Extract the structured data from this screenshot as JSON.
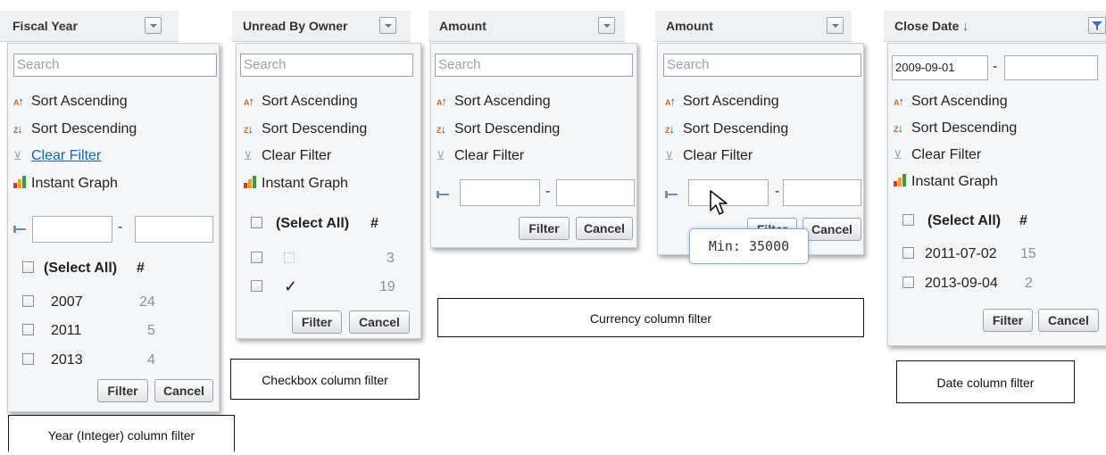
{
  "panels": {
    "fiscal_year": {
      "header": "Fiscal Year",
      "search_placeholder": "Search",
      "sort_asc": "Sort Ascending",
      "sort_desc": "Sort Descending",
      "clear_filter": "Clear Filter",
      "instant_graph": "Instant Graph",
      "range_separator": "-",
      "select_all": "(Select All)",
      "count_header": "#",
      "rows": [
        {
          "label": "2007",
          "count": "24"
        },
        {
          "label": "2011",
          "count": "5"
        },
        {
          "label": "2013",
          "count": "4"
        }
      ],
      "filter_button": "Filter",
      "cancel_button": "Cancel"
    },
    "unread_by_owner": {
      "header": "Unread By Owner",
      "search_placeholder": "Search",
      "sort_asc": "Sort Ascending",
      "sort_desc": "Sort Descending",
      "clear_filter": "Clear Filter",
      "instant_graph": "Instant Graph",
      "select_all": "(Select All)",
      "count_header": "#",
      "rows": [
        {
          "label": "",
          "count": "3"
        },
        {
          "label": "✓",
          "count": "19"
        }
      ],
      "filter_button": "Filter",
      "cancel_button": "Cancel"
    },
    "amount_1": {
      "header": "Amount",
      "search_placeholder": "Search",
      "sort_asc": "Sort Ascending",
      "sort_desc": "Sort Descending",
      "clear_filter": "Clear Filter",
      "range_separator": "-",
      "filter_button": "Filter",
      "cancel_button": "Cancel"
    },
    "amount_2": {
      "header": "Amount",
      "search_placeholder": "Search",
      "sort_asc": "Sort Ascending",
      "sort_desc": "Sort Descending",
      "clear_filter": "Clear Filter",
      "range_separator": "-",
      "filter_button": "Filter",
      "cancel_button": "Cancel",
      "tooltip": "Min: 35000"
    },
    "close_date": {
      "header": "Close Date",
      "sort_indicator": "↓",
      "date_from": "2009-09-01",
      "range_separator": "-",
      "sort_asc": "Sort Ascending",
      "sort_desc": "Sort Descending",
      "clear_filter": "Clear Filter",
      "instant_graph": "Instant Graph",
      "select_all": "(Select All)",
      "count_header": "#",
      "rows": [
        {
          "label": "2011-07-02",
          "count": "15"
        },
        {
          "label": "2013-09-04",
          "count": "2"
        }
      ],
      "filter_button": "Filter",
      "cancel_button": "Cancel"
    }
  },
  "captions": {
    "year": "Year (Integer) column filter",
    "checkbox": "Checkbox column filter",
    "currency": "Currency column filter",
    "date": "Date column filter"
  },
  "icons": {
    "header_menu": "chevron-down-icon",
    "header_filtered": "funnel-icon",
    "sort_asc": "sort-ascending-icon",
    "sort_desc": "sort-descending-icon",
    "clear_filter": "clear-filter-icon",
    "instant_graph": "bar-chart-icon",
    "range": "range-icon",
    "cursor": "mouse-pointer-icon"
  },
  "colors": {
    "link": "#1a62b8",
    "sort_indicator": "#1a63c4",
    "tooltip_border": "#8ab1d6",
    "graph_bars": [
      "#d93b1a",
      "#e8a317",
      "#3d9a3a"
    ]
  }
}
